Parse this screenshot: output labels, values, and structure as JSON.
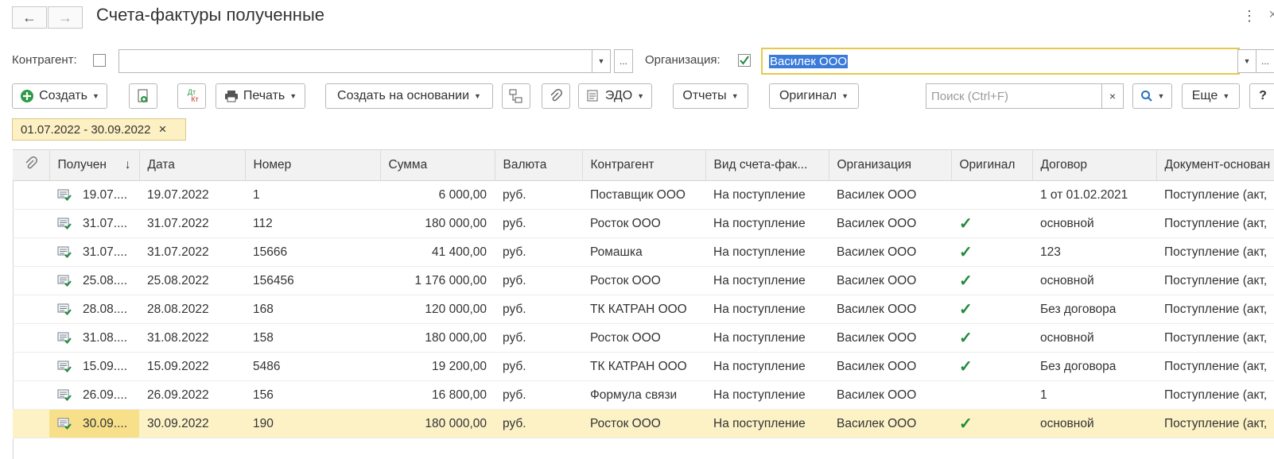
{
  "header": {
    "title": "Счета-фактуры полученные",
    "back_icon": "←",
    "forward_icon": "→",
    "more_icon": "⋮",
    "close_icon": "×"
  },
  "filters": {
    "counterparty_label": "Контрагент:",
    "counterparty_checked": false,
    "counterparty_value": "",
    "organization_label": "Организация:",
    "organization_checked": true,
    "organization_value": "Василек ООО",
    "dots": "..."
  },
  "toolbar": {
    "create": "Создать",
    "print": "Печать",
    "create_based": "Создать на основании",
    "edo": "ЭДО",
    "reports": "Отчеты",
    "original": "Оригинал",
    "search_placeholder": "Поиск (Ctrl+F)",
    "search_clear": "×",
    "more": "Еще",
    "help": "?",
    "dt_kt_top": "Дт",
    "dt_kt_bottom": "Кт"
  },
  "period_filter": {
    "label": "01.07.2022 - 30.09.2022",
    "remove": "×"
  },
  "table": {
    "columns": [
      "Получен",
      "Дата",
      "Номер",
      "Сумма",
      "Валюта",
      "Контрагент",
      "Вид счета-фак...",
      "Организация",
      "Оригинал",
      "Договор",
      "Документ-основан"
    ],
    "sort_indicator": "↓",
    "rows": [
      {
        "received": "19.07....",
        "date": "19.07.2022",
        "number": "1",
        "sum": "6 000,00",
        "currency": "руб.",
        "counterparty": "Поставщик ООО",
        "kind": "На поступление",
        "org": "Василек ООО",
        "original": false,
        "contract": "1 от 01.02.2021",
        "base": "Поступление (акт,"
      },
      {
        "received": "31.07....",
        "date": "31.07.2022",
        "number": "112",
        "sum": "180 000,00",
        "currency": "руб.",
        "counterparty": "Росток ООО",
        "kind": "На поступление",
        "org": "Василек ООО",
        "original": true,
        "contract": "основной",
        "base": "Поступление (акт,"
      },
      {
        "received": "31.07....",
        "date": "31.07.2022",
        "number": "15666",
        "sum": "41 400,00",
        "currency": "руб.",
        "counterparty": "Ромашка",
        "kind": "На поступление",
        "org": "Василек ООО",
        "original": true,
        "contract": "123",
        "base": "Поступление (акт,"
      },
      {
        "received": "25.08....",
        "date": "25.08.2022",
        "number": "156456",
        "sum": "1 176 000,00",
        "currency": "руб.",
        "counterparty": "Росток ООО",
        "kind": "На поступление",
        "org": "Василек ООО",
        "original": true,
        "contract": "основной",
        "base": "Поступление (акт,"
      },
      {
        "received": "28.08....",
        "date": "28.08.2022",
        "number": "168",
        "sum": "120 000,00",
        "currency": "руб.",
        "counterparty": "ТК КАТРАН ООО",
        "kind": "На поступление",
        "org": "Василек ООО",
        "original": true,
        "contract": "Без договора",
        "base": "Поступление (акт,"
      },
      {
        "received": "31.08....",
        "date": "31.08.2022",
        "number": "158",
        "sum": "180 000,00",
        "currency": "руб.",
        "counterparty": "Росток ООО",
        "kind": "На поступление",
        "org": "Василек ООО",
        "original": true,
        "contract": "основной",
        "base": "Поступление (акт,"
      },
      {
        "received": "15.09....",
        "date": "15.09.2022",
        "number": "5486",
        "sum": "19 200,00",
        "currency": "руб.",
        "counterparty": "ТК КАТРАН ООО",
        "kind": "На поступление",
        "org": "Василек ООО",
        "original": true,
        "contract": "Без договора",
        "base": "Поступление (акт,"
      },
      {
        "received": "26.09....",
        "date": "26.09.2022",
        "number": "156",
        "sum": "16 800,00",
        "currency": "руб.",
        "counterparty": "Формула связи",
        "kind": "На поступление",
        "org": "Василек ООО",
        "original": false,
        "contract": "1",
        "base": "Поступление (акт,"
      },
      {
        "received": "30.09....",
        "date": "30.09.2022",
        "number": "190",
        "sum": "180 000,00",
        "currency": "руб.",
        "counterparty": "Росток ООО",
        "kind": "На поступление",
        "org": "Василек ООО",
        "original": true,
        "contract": "основной",
        "base": "Поступление (акт,",
        "selected": true
      }
    ],
    "check_mark": "✓"
  },
  "colors": {
    "accent_green": "#1f8a3b",
    "selected_row": "#fdf2c6",
    "focus_border": "#e8c84a",
    "selection_blue": "#3a7ad9"
  }
}
